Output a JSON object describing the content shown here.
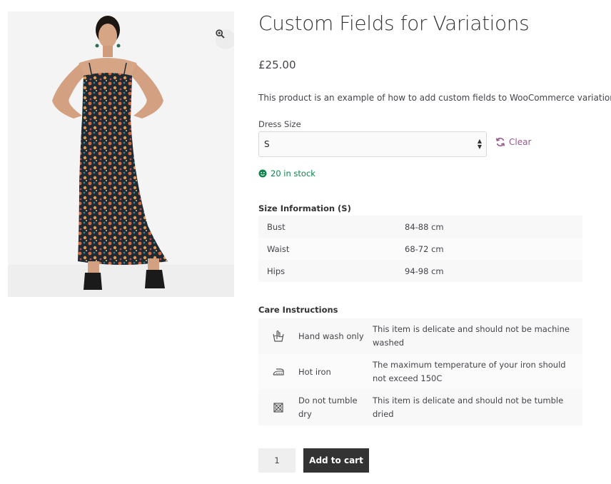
{
  "product": {
    "title": "Custom Fields for Variations",
    "price": "£25.00",
    "description": "This product is an example of how to add custom fields to WooCommerce variations"
  },
  "variation": {
    "label": "Dress Size",
    "selected": "S",
    "clear_label": "Clear",
    "stock_text": "20 in stock"
  },
  "size_info": {
    "heading": "Size Information (S)",
    "rows": [
      {
        "name": "Bust",
        "value": "84-88 cm"
      },
      {
        "name": "Waist",
        "value": "68-72 cm"
      },
      {
        "name": "Hips",
        "value": "94-98 cm"
      }
    ]
  },
  "care": {
    "heading": "Care Instructions",
    "rows": [
      {
        "icon": "hand-wash-icon",
        "name": "Hand wash only",
        "description": "This item is delicate and should not be machine washed"
      },
      {
        "icon": "iron-icon",
        "name": "Hot iron",
        "description": "The maximum temperature of your iron should not exceed 150C"
      },
      {
        "icon": "no-tumble-dry-icon",
        "name": "Do not tumble dry",
        "description": "This item is delicate and should not be tumble dried"
      }
    ]
  },
  "cart": {
    "quantity": "1",
    "add_label": "Add to cart"
  },
  "colors": {
    "accent": "#96588a",
    "stock": "#0f834d",
    "button": "#333333"
  }
}
